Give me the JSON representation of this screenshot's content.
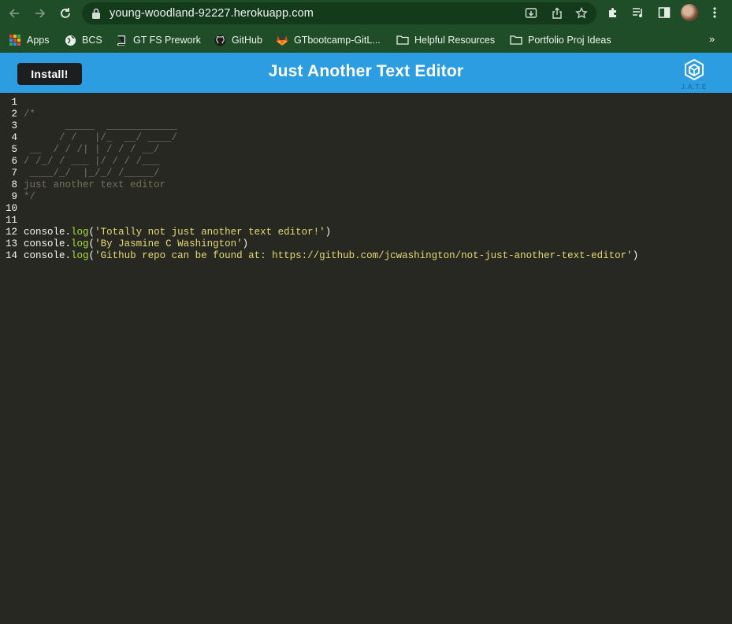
{
  "browser": {
    "url": "young-woodland-92227.herokuapp.com",
    "bookmarks": [
      {
        "label": "Apps",
        "icon": "apps-grid-icon"
      },
      {
        "label": "BCS",
        "icon": "globe-icon"
      },
      {
        "label": "GT FS Prework",
        "icon": "book-icon"
      },
      {
        "label": "GitHub",
        "icon": "github-icon"
      },
      {
        "label": "GTbootcamp-GitL...",
        "icon": "gitlab-icon"
      },
      {
        "label": "Helpful Resources",
        "icon": "folder-icon"
      },
      {
        "label": "Portfolio Proj Ideas",
        "icon": "folder-icon"
      }
    ],
    "more_label": "»"
  },
  "app": {
    "install_label": "Install!",
    "title": "Just Another Text Editor",
    "logo_text": "J.A.T.E",
    "colors": {
      "header": "#2c9de0",
      "editor_bg": "#272822"
    }
  },
  "editor": {
    "lines": [
      {
        "num": "1",
        "tokens": []
      },
      {
        "num": "2",
        "tokens": [
          {
            "t": "/*",
            "c": "comment"
          }
        ]
      },
      {
        "num": "3",
        "tokens": [
          {
            "t": "       _____  ____________",
            "c": "comment"
          }
        ]
      },
      {
        "num": "4",
        "tokens": [
          {
            "t": "      / /   |/_  __/ ____/",
            "c": "comment"
          }
        ]
      },
      {
        "num": "5",
        "tokens": [
          {
            "t": " __  / / /| | / / / __/",
            "c": "comment"
          }
        ]
      },
      {
        "num": "6",
        "tokens": [
          {
            "t": "/ /_/ / ___ |/ / / /___",
            "c": "comment"
          }
        ]
      },
      {
        "num": "7",
        "tokens": [
          {
            "t": " ____/_/  |_/_/ /_____/",
            "c": "comment"
          }
        ]
      },
      {
        "num": "8",
        "tokens": [
          {
            "t": "just another text editor",
            "c": "comment"
          }
        ]
      },
      {
        "num": "9",
        "tokens": [
          {
            "t": "*/",
            "c": "comment"
          }
        ]
      },
      {
        "num": "10",
        "tokens": []
      },
      {
        "num": "11",
        "tokens": []
      },
      {
        "num": "12",
        "tokens": [
          {
            "t": "console",
            "c": "plain"
          },
          {
            "t": ".",
            "c": "plain"
          },
          {
            "t": "log",
            "c": "fn"
          },
          {
            "t": "(",
            "c": "plain"
          },
          {
            "t": "'Totally not just another text editor!'",
            "c": "str"
          },
          {
            "t": ")",
            "c": "plain"
          }
        ]
      },
      {
        "num": "13",
        "tokens": [
          {
            "t": "console",
            "c": "plain"
          },
          {
            "t": ".",
            "c": "plain"
          },
          {
            "t": "log",
            "c": "fn"
          },
          {
            "t": "(",
            "c": "plain"
          },
          {
            "t": "'By Jasmine C Washington'",
            "c": "str"
          },
          {
            "t": ")",
            "c": "plain"
          }
        ]
      },
      {
        "num": "14",
        "tokens": [
          {
            "t": "console",
            "c": "plain"
          },
          {
            "t": ".",
            "c": "plain"
          },
          {
            "t": "log",
            "c": "fn"
          },
          {
            "t": "(",
            "c": "plain"
          },
          {
            "t": "'Github repo can be found at: https://github.com/jcwashington/not-just-another-text-editor'",
            "c": "str"
          },
          {
            "t": ")",
            "c": "plain"
          }
        ]
      }
    ]
  }
}
